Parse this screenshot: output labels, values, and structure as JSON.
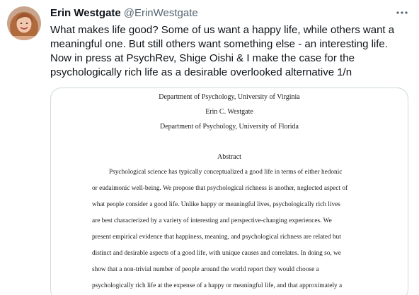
{
  "author": {
    "display_name": "Erin Westgate",
    "handle": "@ErinWestgate",
    "avatar_icon": "profile-photo"
  },
  "more_icon": "more-horizontal-icon",
  "tweet_text_lines": [
    "What makes life good? Some of us want a happy life, while others want a",
    "meaningful one. But still others want something else - an interesting life.",
    "Now in press at PsychRev, Shige Oishi & I make the case for the",
    "psychologically rich life as a desirable overlooked alternative 1/n"
  ],
  "document": {
    "affiliation_1": "Department of Psychology, University of Virginia",
    "author_name": "Erin C. Westgate",
    "affiliation_2": "Department of Psychology, University of Florida",
    "abstract_heading": "Abstract",
    "abstract_lines": [
      "Psychological science has typically conceptualized a good life in terms of either hedonic",
      "or eudaimonic well-being. We propose that psychological richness is another, neglected aspect of",
      "what people consider a good life. Unlike happy or meaningful lives, psychologically rich lives",
      "are best characterized by a variety of interesting and perspective-changing experiences. We",
      "present empirical evidence that happiness, meaning, and psychological richness are related but",
      "distinct and desirable aspects of a good life, with unique causes and correlates. In doing so, we",
      "show that a non-trivial number of people around the world report they would choose a",
      "psychologically rich life at the expense of a happy or meaningful life, and that approximately a"
    ]
  },
  "colors": {
    "text_primary": "#0f1419",
    "text_secondary": "#536471",
    "card_border": "#cfd9de"
  }
}
